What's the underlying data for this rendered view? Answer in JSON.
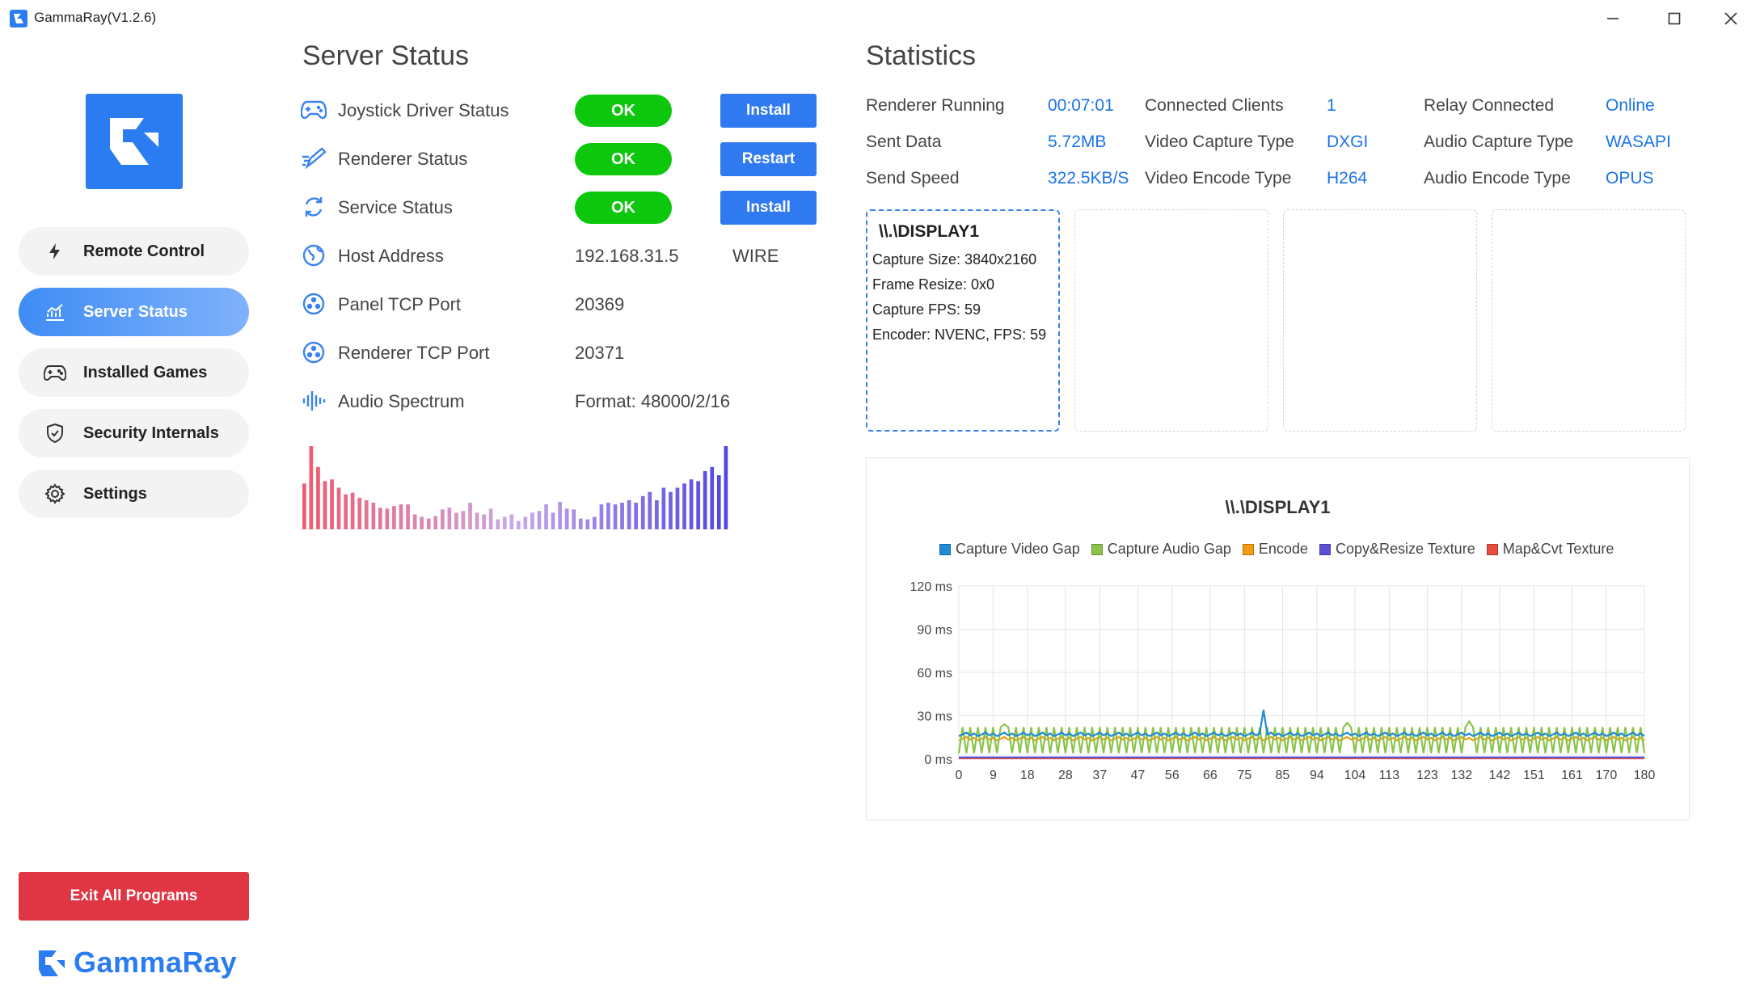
{
  "window": {
    "title": "GammaRay(V1.2.6)"
  },
  "sidebar": {
    "items": [
      {
        "label": "Remote Control",
        "icon": "lightning-icon"
      },
      {
        "label": "Server Status",
        "icon": "chart-icon",
        "active": true
      },
      {
        "label": "Installed Games",
        "icon": "gamepad-icon"
      },
      {
        "label": "Security Internals",
        "icon": "shield-icon"
      },
      {
        "label": "Settings",
        "icon": "gear-icon"
      }
    ],
    "exit_label": "Exit All Programs",
    "brand": "GammaRay"
  },
  "server_status": {
    "title": "Server Status",
    "rows": [
      {
        "label": "Joystick Driver Status",
        "status": "OK",
        "action": "Install"
      },
      {
        "label": "Renderer Status",
        "status": "OK",
        "action": "Restart"
      },
      {
        "label": "Service Status",
        "status": "OK",
        "action": "Install"
      },
      {
        "label": "Host Address",
        "value": "192.168.31.5",
        "extra": "WIRE"
      },
      {
        "label": "Panel TCP Port",
        "value": "20369"
      },
      {
        "label": "Renderer TCP Port",
        "value": "20371"
      },
      {
        "label": "Audio Spectrum",
        "value": "Format: 48000/2/16"
      }
    ],
    "spectrum_levels": [
      0.55,
      1.0,
      0.75,
      0.58,
      0.6,
      0.5,
      0.42,
      0.44,
      0.38,
      0.35,
      0.32,
      0.26,
      0.25,
      0.28,
      0.3,
      0.3,
      0.18,
      0.15,
      0.13,
      0.16,
      0.24,
      0.26,
      0.2,
      0.22,
      0.32,
      0.2,
      0.18,
      0.25,
      0.12,
      0.15,
      0.18,
      0.1,
      0.15,
      0.2,
      0.22,
      0.3,
      0.2,
      0.33,
      0.25,
      0.24,
      0.13,
      0.12,
      0.15,
      0.3,
      0.32,
      0.3,
      0.32,
      0.35,
      0.32,
      0.4,
      0.45,
      0.35,
      0.5,
      0.45,
      0.5,
      0.55,
      0.6,
      0.58,
      0.7,
      0.75,
      0.65,
      1.0
    ]
  },
  "statistics": {
    "title": "Statistics",
    "items": [
      {
        "label": "Renderer Running",
        "value": "00:07:01"
      },
      {
        "label": "Connected Clients",
        "value": "1"
      },
      {
        "label": "Relay Connected",
        "value": "Online"
      },
      {
        "label": "Sent Data",
        "value": "5.72MB"
      },
      {
        "label": "Video Capture Type",
        "value": "DXGI"
      },
      {
        "label": "Audio Capture Type",
        "value": "WASAPI"
      },
      {
        "label": "Send Speed",
        "value": "322.5KB/S"
      },
      {
        "label": "Video Encode Type",
        "value": "H264"
      },
      {
        "label": "Audio Encode Type",
        "value": "OPUS"
      }
    ],
    "display_card": {
      "title": "\\\\.\\DISPLAY1",
      "lines": [
        "Capture Size: 3840x2160",
        "Frame Resize: 0x0",
        "Capture FPS: 59",
        "Encoder: NVENC, FPS: 59"
      ]
    }
  },
  "chart_data": {
    "type": "line",
    "title": "\\\\.\\DISPLAY1",
    "ylim": [
      0,
      120
    ],
    "y_ticks": [
      "0 ms",
      "30 ms",
      "60 ms",
      "90 ms",
      "120 ms"
    ],
    "x_ticks": [
      "0",
      "9",
      "18",
      "28",
      "37",
      "47",
      "56",
      "66",
      "75",
      "85",
      "94",
      "104",
      "113",
      "123",
      "132",
      "142",
      "151",
      "161",
      "170",
      "180"
    ],
    "grid": true,
    "legend_position": "top",
    "series": [
      {
        "name": "Capture Video Gap",
        "color": "#1f8ad6",
        "base": 17,
        "spikes": [
          [
            80,
            34
          ]
        ]
      },
      {
        "name": "Capture Audio Gap",
        "color": "#8bc34a",
        "base": 12,
        "zigzag": [
          4,
          22
        ],
        "spikes": [
          [
            12,
            24
          ],
          [
            102,
            25
          ],
          [
            134,
            26
          ]
        ]
      },
      {
        "name": "Encode",
        "color": "#f39c12",
        "base": 14
      },
      {
        "name": "Copy&Resize Texture",
        "color": "#5b4fd6",
        "base": 1
      },
      {
        "name": "Map&Cvt Texture",
        "color": "#e74c3c",
        "base": 0.5
      }
    ]
  }
}
